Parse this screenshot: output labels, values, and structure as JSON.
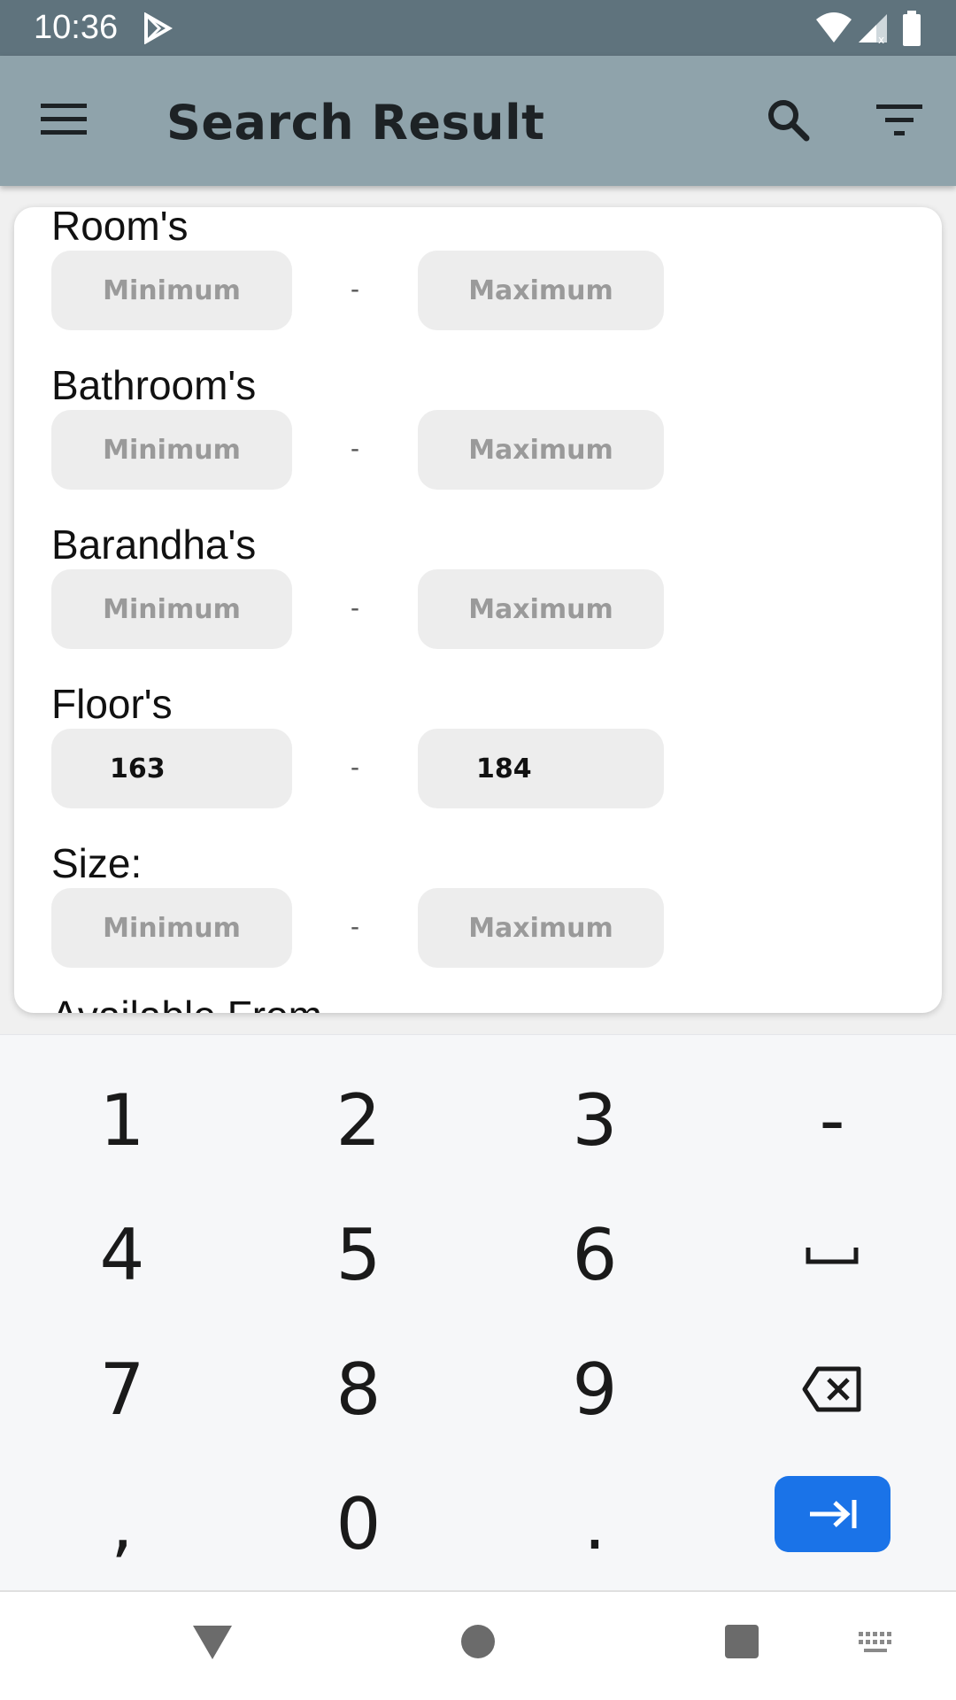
{
  "status_bar": {
    "time": "10:36",
    "icons": [
      "play-store-icon",
      "wifi-icon",
      "signal-icon",
      "battery-icon"
    ]
  },
  "app_bar": {
    "title": "Search Result",
    "icons": [
      "menu-icon",
      "search-icon",
      "filter-icon"
    ]
  },
  "form": {
    "fields": [
      {
        "label": "Room's",
        "min_placeholder": "Minimum",
        "max_placeholder": "Maximum",
        "min_value": "",
        "max_value": ""
      },
      {
        "label": "Bathroom's",
        "min_placeholder": "Minimum",
        "max_placeholder": "Maximum",
        "min_value": "",
        "max_value": ""
      },
      {
        "label": "Barandha's",
        "min_placeholder": "Minimum",
        "max_placeholder": "Maximum",
        "min_value": "",
        "max_value": ""
      },
      {
        "label": "Floor's",
        "min_placeholder": "Minimum",
        "max_placeholder": "Maximum",
        "min_value": "163",
        "max_value": "184"
      },
      {
        "label": "Size:",
        "min_placeholder": "Minimum",
        "max_placeholder": "Maximum",
        "min_value": "",
        "max_value": ""
      }
    ],
    "separator": "-",
    "next_label_partial": "Available From"
  },
  "keyboard": {
    "keys": [
      "1",
      "2",
      "3",
      "-",
      "4",
      "5",
      "6",
      "7",
      "8",
      "9",
      ",",
      "0",
      "."
    ],
    "special_keys": [
      "space-key",
      "backspace-key",
      "next-field-key"
    ],
    "accent_color": "#1a73e8"
  },
  "nav_bar": {
    "buttons": [
      "back-triangle-icon",
      "home-circle-icon",
      "recents-square-icon",
      "keyboard-switch-icon"
    ]
  },
  "colors": {
    "status_bar": "#5f737d",
    "app_bar": "#8fa3ab",
    "input_bg": "#ededed"
  }
}
